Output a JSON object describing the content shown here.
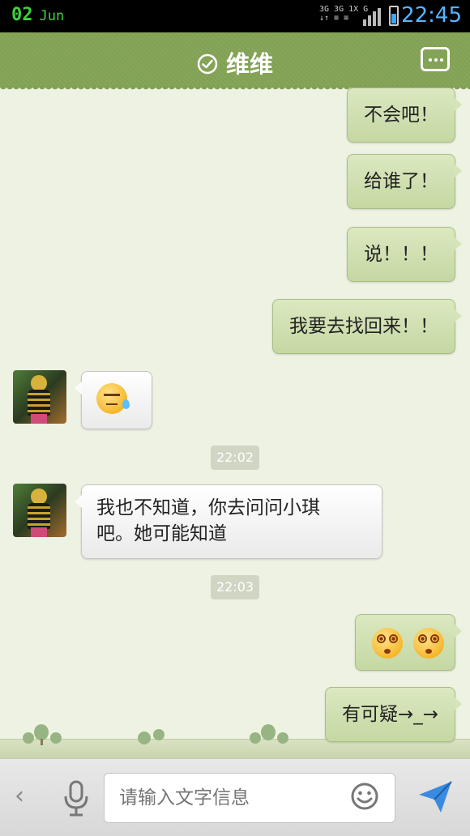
{
  "status_bar": {
    "date_day": "02",
    "date_month": "Jun",
    "network_line1": "3G 3G 1X G",
    "network_line2": "↓↑ ≡ ≡",
    "time": "22:45",
    "battery_level": 0.55
  },
  "header": {
    "title": "维维",
    "verified_icon": "check-circle-icon",
    "menu_icon": "more-dots-icon"
  },
  "messages": [
    {
      "id": "m1",
      "direction": "outgoing",
      "text": "不会吧！"
    },
    {
      "id": "m2",
      "direction": "outgoing",
      "text": "给谁了！"
    },
    {
      "id": "m3",
      "direction": "outgoing",
      "text": "说！！！"
    },
    {
      "id": "m4",
      "direction": "outgoing",
      "text": "我要去找回来！！"
    },
    {
      "id": "m5",
      "direction": "incoming",
      "emoji": "sweat-face-emoji"
    },
    {
      "id": "t1",
      "type": "timestamp",
      "text": "22:02"
    },
    {
      "id": "m6",
      "direction": "incoming",
      "text_line1": "我也不知道，你去问问小琪",
      "text_line2": "吧。她可能知道"
    },
    {
      "id": "t2",
      "type": "timestamp",
      "text": "22:03"
    },
    {
      "id": "m7",
      "direction": "outgoing",
      "emoji": "dizzy-face-emoji",
      "count": 2
    },
    {
      "id": "m8",
      "direction": "outgoing",
      "text": "有可疑→_→"
    }
  ],
  "input_bar": {
    "placeholder": "请输入文字信息",
    "back_icon": "chevron-left-icon",
    "voice_icon": "microphone-icon",
    "emoji_icon": "smiley-icon",
    "send_icon": "send-icon"
  },
  "colors": {
    "header": "#81a153",
    "chat_bg": "#eef2e2",
    "outgoing_bubble": "#d0e0b2",
    "incoming_bubble": "#f4f4f4",
    "send_accent": "#3a8be0"
  }
}
